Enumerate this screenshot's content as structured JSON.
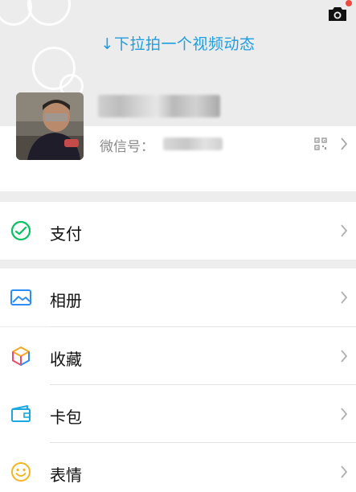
{
  "header": {
    "pull_hint": "↓下拉拍一个视频动态",
    "camera_icon": "camera-icon",
    "notification_color": "#f04a3f"
  },
  "profile": {
    "wechat_id_label": "微信号：",
    "qr_icon": "qr-code-icon",
    "chevron_icon": "chevron-right-icon"
  },
  "menu": {
    "items": [
      {
        "label": "支付",
        "icon": "pay-icon",
        "color": "#07c160"
      },
      {
        "label": "相册",
        "icon": "album-icon",
        "color": "#2c8ef4"
      },
      {
        "label": "收藏",
        "icon": "favorites-icon",
        "color": "#f6a623"
      },
      {
        "label": "卡包",
        "icon": "card-wallet-icon",
        "color": "#1aa8e0"
      },
      {
        "label": "表情",
        "icon": "sticker-icon",
        "color": "#f6b51e"
      }
    ]
  },
  "colors": {
    "accent_blue": "#1e9ee2",
    "background": "#ededed",
    "surface": "#ffffff"
  }
}
